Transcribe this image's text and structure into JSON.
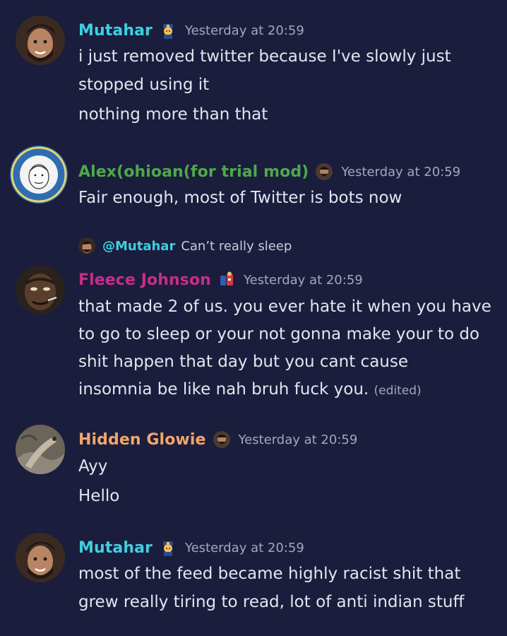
{
  "colors": {
    "background": "#1b1d3d",
    "mutahar": "#3ecfe0",
    "alex": "#4fa84a",
    "fleece": "#c72d8a",
    "glowie": "#f0a66a",
    "timestamp": "#a3a6bd",
    "text": "#e4e5ee"
  },
  "messages": [
    {
      "username": "Mutahar",
      "badge_icon": "police-officer-emoji-icon",
      "timestamp": "Yesterday at 20:59",
      "lines": [
        "i just removed twitter because I've slowly just",
        "stopped using it",
        "nothing more than that"
      ]
    },
    {
      "username": "Alex(ohioan(for trial mod)",
      "badge_icon": "user-avatar-badge-icon",
      "timestamp": "Yesterday at 20:59",
      "lines": [
        "Fair enough, most of Twitter is bots now"
      ]
    },
    {
      "reply": {
        "name": "@Mutahar",
        "text": "Can’t really sleep"
      },
      "username": "Fleece Johnson",
      "badge_icon": "character-emoji-icon",
      "timestamp": "Yesterday at 20:59",
      "lines": [
        "that made 2 of us. you ever hate it when you have",
        "to go to sleep or your not gonna make your to do",
        "shit happen that day but you cant cause",
        "insomnia be like nah bruh fuck you."
      ],
      "edited": "(edited)"
    },
    {
      "username": "Hidden Glowie",
      "badge_icon": "user-avatar-badge-icon",
      "timestamp": "Yesterday at 20:59",
      "lines": [
        "Ayy",
        "Hello"
      ]
    },
    {
      "username": "Mutahar",
      "badge_icon": "police-officer-emoji-icon",
      "timestamp": "Yesterday at 20:59",
      "lines": [
        "most of the feed became highly racist shit that",
        "grew really tiring to read, lot of anti indian stuff"
      ]
    }
  ]
}
